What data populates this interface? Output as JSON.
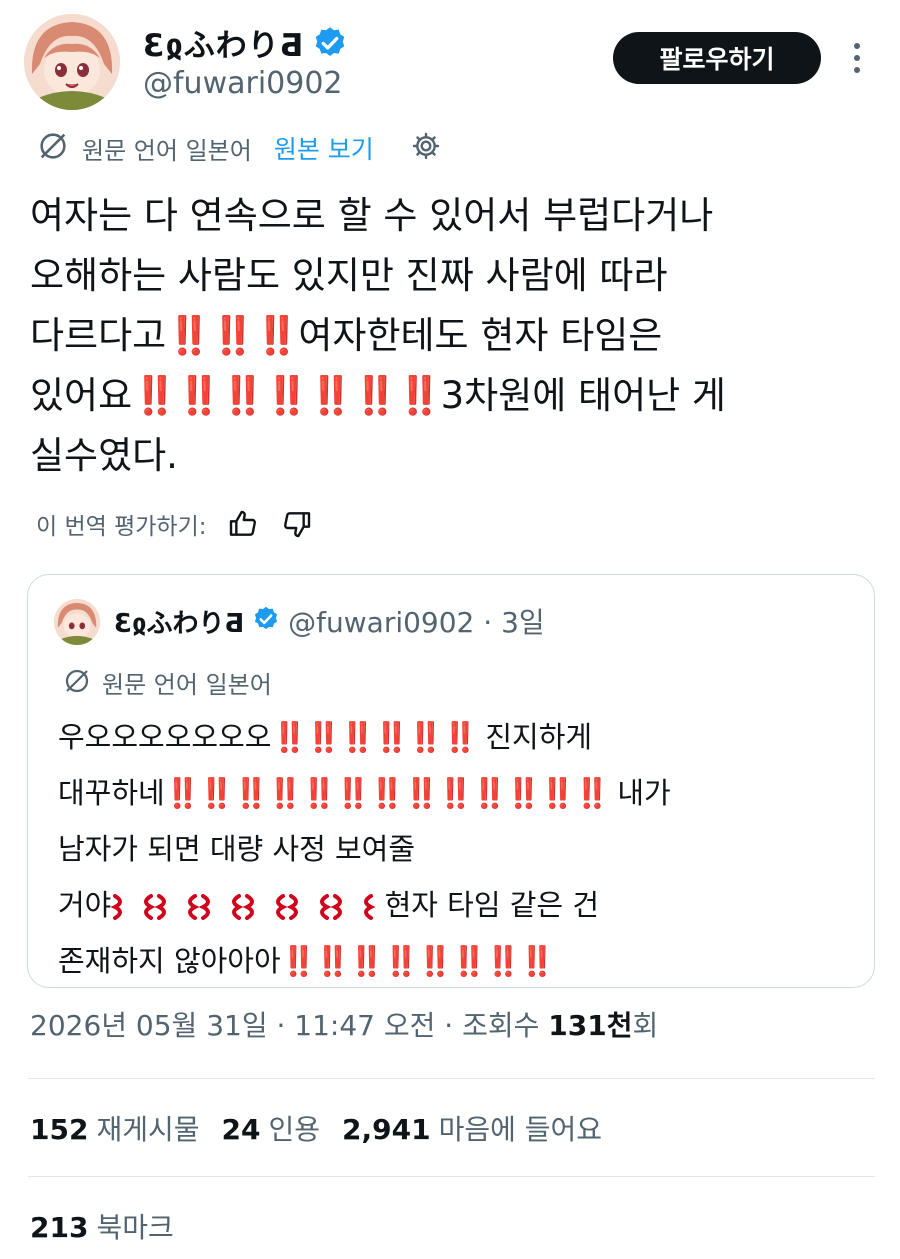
{
  "author": {
    "display_name": "ƐჲふわりƋ",
    "handle": "@fuwari0902"
  },
  "follow_label": "팔로우하기",
  "translation": {
    "source_label": "원문 언어 일본어",
    "view_original": "원본 보기",
    "rate_label": "이 번역 평가하기:"
  },
  "tweet_lines": [
    {
      "pre": "여자는 다 연속으로 할 수 있어서 부럽다거나",
      "excl": "",
      "post": ""
    },
    {
      "pre": "오해하는 사람도 있지만 진짜 사람에 따라",
      "excl": "",
      "post": ""
    },
    {
      "pre": "다르다고",
      "excl": "‼️‼️‼️",
      "post": "여자한테도 현자 타임은"
    },
    {
      "pre": "있어요",
      "excl": "‼️‼️‼️‼️‼️‼️‼️",
      "post": "3차원에 태어난 게"
    },
    {
      "pre": "실수였다.",
      "excl": "",
      "post": ""
    }
  ],
  "quote": {
    "display_name": "ƐჲふわりƋ",
    "meta": "@fuwari0902 · 3일",
    "source_label": "원문 언어 일본어",
    "lines": [
      {
        "pre": "우오오오오오오오",
        "excl": "‼️‼️‼️‼️‼️‼️",
        "angry": 0,
        "post": " 진지하게"
      },
      {
        "pre": "대꾸하네",
        "excl": "‼️‼️‼️‼️‼️‼️‼️‼️‼️‼️‼️‼️‼️",
        "angry": 0,
        "post": " 내가"
      },
      {
        "pre": "남자가 되면 대량 사정 보여줄",
        "excl": "",
        "angry": 0,
        "post": ""
      },
      {
        "pre": "거야",
        "excl": "",
        "angry": 6,
        "post": " 현자 타임 같은 건"
      },
      {
        "pre": "존재하지 않아아아",
        "excl": "‼️‼️‼️‼️‼️‼️‼️‼️",
        "angry": 0,
        "post": ""
      }
    ]
  },
  "timestamp": {
    "text": "2026년 05월 31일 · 11:47 오전 · 조회수 ",
    "views_num": "131천",
    "views_suffix": "회"
  },
  "stats": {
    "retweets_count": "152",
    "retweets_label": "재게시물",
    "quotes_count": "24",
    "quotes_label": "인용",
    "likes_count": "2,941",
    "likes_label": "마음에 들어요"
  },
  "bookmarks": {
    "count": "213",
    "label": "북마크"
  },
  "colors": {
    "accent": "#1d9bf0",
    "text": "#0f1419",
    "secondary": "#536471",
    "exclamation": "#d0021b",
    "follow_bg": "#0f1419"
  }
}
